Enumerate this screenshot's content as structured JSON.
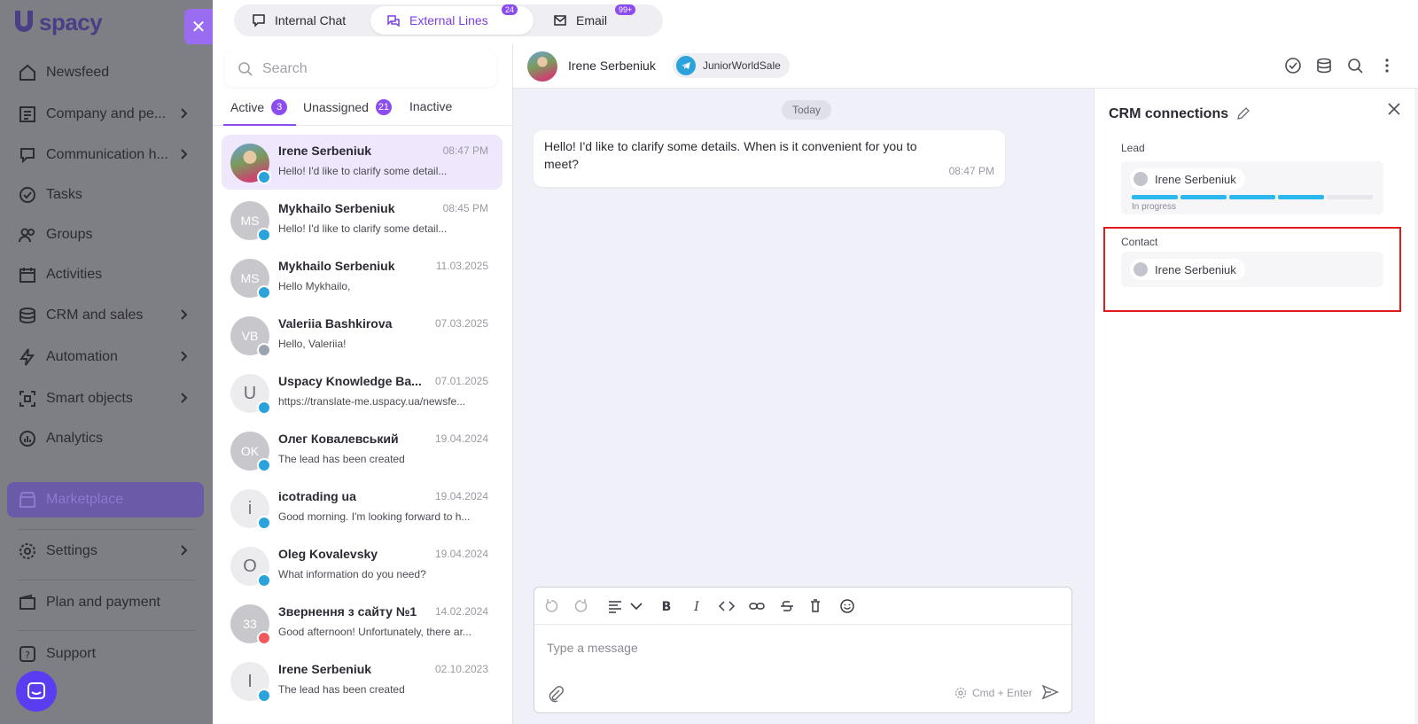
{
  "nav": {
    "logo_text": "spacy",
    "items": [
      {
        "label": "Newsfeed",
        "icon": "home-icon",
        "chevron": false
      },
      {
        "label": "Company and pe...",
        "icon": "company-icon",
        "chevron": true
      },
      {
        "label": "Communication h...",
        "icon": "communication-icon",
        "chevron": true
      },
      {
        "label": "Tasks",
        "icon": "tasks-icon",
        "chevron": false
      },
      {
        "label": "Groups",
        "icon": "groups-icon",
        "chevron": false
      },
      {
        "label": "Activities",
        "icon": "calendar-icon",
        "chevron": false
      },
      {
        "label": "CRM and sales",
        "icon": "crm-icon",
        "chevron": true
      },
      {
        "label": "Automation",
        "icon": "lightning-icon",
        "chevron": true
      },
      {
        "label": "Smart objects",
        "icon": "smart-objects-icon",
        "chevron": true
      },
      {
        "label": "Analytics",
        "icon": "analytics-icon",
        "chevron": false
      },
      {
        "label": "Marketplace",
        "icon": "marketplace-icon",
        "chevron": false
      },
      {
        "label": "Settings",
        "icon": "gear-icon",
        "chevron": true
      },
      {
        "label": "Plan and payment",
        "icon": "wallet-icon",
        "chevron": false
      },
      {
        "label": "Support",
        "icon": "support-icon",
        "chevron": false
      }
    ]
  },
  "top_tabs": [
    {
      "label": "Internal Chat",
      "badge": ""
    },
    {
      "label": "External Lines",
      "badge": "24"
    },
    {
      "label": "Email",
      "badge": "99+"
    }
  ],
  "list": {
    "search_placeholder": "Search",
    "subtabs": [
      {
        "label": "Active",
        "count": "3"
      },
      {
        "label": "Unassigned",
        "count": "21"
      },
      {
        "label": "Inactive",
        "count": ""
      }
    ],
    "conversations": [
      {
        "initials": "",
        "name": "Irene Serbeniuk",
        "time": "08:47 PM",
        "preview": "Hello! I'd like to clarify some detail..."
      },
      {
        "initials": "MS",
        "name": "Mykhailo Serbeniuk",
        "time": "08:45 PM",
        "preview": "Hello! I'd like to clarify some detail..."
      },
      {
        "initials": "MS",
        "name": "Mykhailo Serbeniuk",
        "time": "11.03.2025",
        "preview": "Hello Mykhailo,"
      },
      {
        "initials": "VB",
        "name": "Valeriia Bashkirova",
        "time": "07.03.2025",
        "preview": "Hello, Valeriia!"
      },
      {
        "initials": "U",
        "name": "Uspacy Knowledge Ba...",
        "time": "07.01.2025",
        "preview": "https://translate-me.uspacy.ua/newsfe..."
      },
      {
        "initials": "OK",
        "name": "Олег Ковалевський",
        "time": "19.04.2024",
        "preview": "The lead has been created"
      },
      {
        "initials": "i",
        "name": "icotrading ua",
        "time": "19.04.2024",
        "preview": "Good morning. I'm looking forward to h..."
      },
      {
        "initials": "O",
        "name": "Oleg Kovalevsky",
        "time": "19.04.2024",
        "preview": "What information do you need?"
      },
      {
        "initials": "33",
        "name": "Звернення з сайту №1",
        "time": "14.02.2024",
        "preview": "Good afternoon! Unfortunately, there ar..."
      },
      {
        "initials": "I",
        "name": "Irene Serbeniuk",
        "time": "02.10.2023",
        "preview": "The lead has been created"
      }
    ]
  },
  "chat": {
    "contact_name": "Irene Serbeniuk",
    "channel_name": "JuniorWorldSale",
    "day_label": "Today",
    "message_text": "Hello! I'd like to clarify some details. When is it convenient for you to meet?",
    "message_time": "08:47 PM",
    "composer_placeholder": "Type a message",
    "send_hint": "Cmd + Enter"
  },
  "crm": {
    "title": "CRM connections",
    "lead_label": "Lead",
    "lead_name": "Irene Serbeniuk",
    "lead_status": "In progress",
    "lead_progress_steps_done": 4,
    "lead_progress_steps_total": 5,
    "contact_label": "Contact",
    "contact_name": "Irene Serbeniuk"
  },
  "colors": {
    "accent": "#8b4cf0",
    "telegram": "#2aa3dd",
    "progress": "#2ab8ee",
    "highlight": "#e01b1b"
  }
}
